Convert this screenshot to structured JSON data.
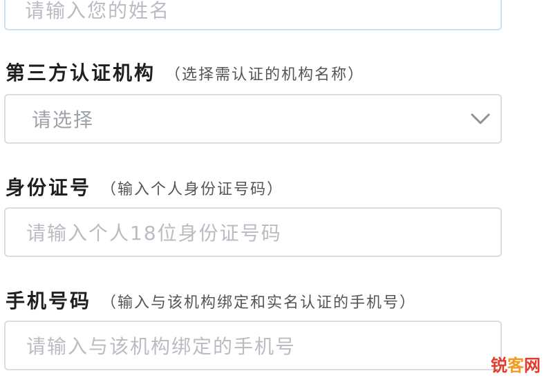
{
  "name_field": {
    "placeholder": "请输入您的姓名"
  },
  "institution": {
    "label": "第三方认证机构",
    "hint": "（选择需认证的机构名称）",
    "selected": "请选择"
  },
  "id_number": {
    "label": "身份证号",
    "hint": "（输入个人身份证号码）",
    "placeholder": "请输入个人18位身份证号码"
  },
  "phone": {
    "label": "手机号码",
    "hint": "（输入与该机构绑定和实名认证的手机号）",
    "placeholder": "请输入与该机构绑定的手机号"
  },
  "watermark": {
    "part1": "锐",
    "part2": "客",
    "part3": "网"
  },
  "icons": {
    "dropdown": "chevron-down-icon"
  }
}
